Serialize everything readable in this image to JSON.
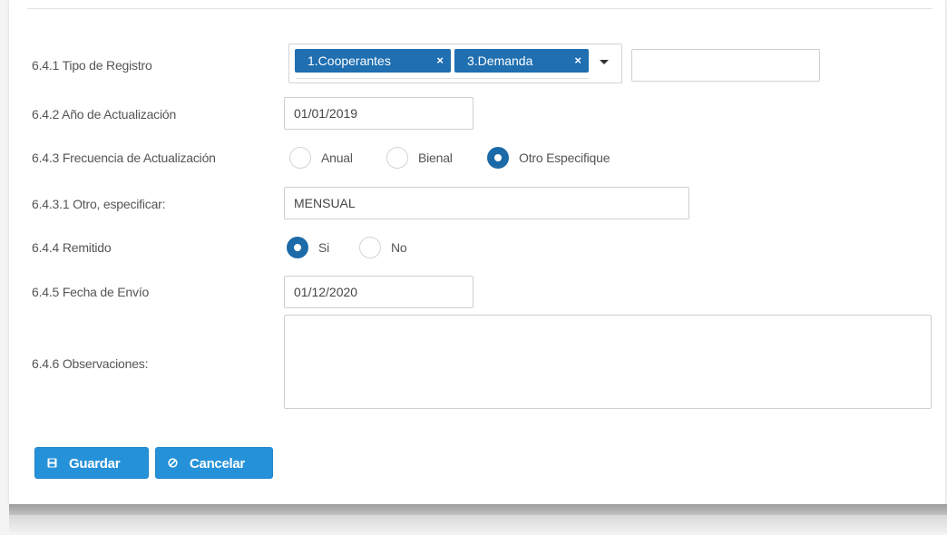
{
  "form": {
    "tipo_registro": {
      "label": "6.4.1 Tipo de Registro",
      "tags": [
        "1.Cooperantes",
        "3.Demanda"
      ],
      "tag_remove_glyph": "×",
      "extra_input_value": ""
    },
    "anio_actualizacion": {
      "label": "6.4.2 Año de Actualización",
      "value": "01/01/2019"
    },
    "frecuencia": {
      "label": "6.4.3 Frecuencia de Actualización",
      "options": [
        "Anual",
        "Bienal",
        "Otro Especifique"
      ],
      "selected": "Otro Especifique"
    },
    "otro_especificar": {
      "label": "6.4.3.1 Otro, especificar:",
      "value": "MENSUAL"
    },
    "remitido": {
      "label": "6.4.4 Remitido",
      "options": [
        "Si",
        "No"
      ],
      "selected": "Si"
    },
    "fecha_envio": {
      "label": "6.4.5 Fecha de Envío",
      "value": "01/12/2020"
    },
    "observaciones": {
      "label": "6.4.6 Observaciones:",
      "value": ""
    }
  },
  "actions": {
    "save_label": "Guardar",
    "save_icon": "floppy-disk-icon",
    "cancel_label": "Cancelar",
    "cancel_icon": "ban-icon"
  },
  "colors": {
    "primary_button": "#2591d9",
    "tag": "#1f6fb1",
    "radio_selected": "#1d6aa8"
  }
}
